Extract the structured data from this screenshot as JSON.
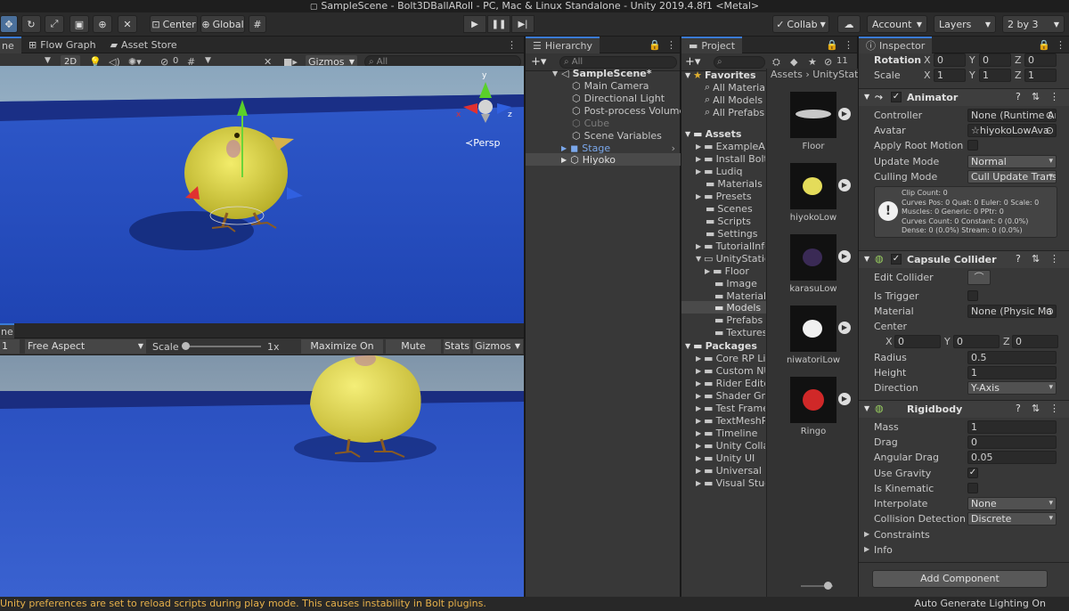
{
  "window": {
    "title": "SampleScene - Bolt3DBallARoll - PC, Mac & Linux Standalone - Unity 2019.4.8f1 <Metal>"
  },
  "toolbar": {
    "pivot_label": "Center",
    "space_label": "Global",
    "collab_label": "Collab",
    "account_label": "Account",
    "layers_label": "Layers",
    "layout_label": "2 by 3"
  },
  "scene_panel": {
    "tabs": [
      "ne",
      "Flow Graph",
      "Asset Store"
    ],
    "mode_2d": "2D",
    "fx_count": "0",
    "gizmos_label": "Gizmos",
    "search_placeholder": "All",
    "persp_label": "Persp",
    "axis_x": "x",
    "axis_z": "z",
    "axis_y": "y"
  },
  "game_panel": {
    "tab": "ne",
    "display": "1",
    "aspect": "Free Aspect",
    "scale_label": "Scale",
    "scale_value": "1x",
    "maximize": "Maximize On Play",
    "mute": "Mute Audio",
    "stats": "Stats",
    "gizmos": "Gizmos"
  },
  "hierarchy": {
    "title": "Hierarchy",
    "search_placeholder": "All",
    "scene_name": "SampleScene*",
    "items": [
      "Main Camera",
      "Directional Light",
      "Post-process Volume",
      "Cube",
      "Scene Variables",
      "Stage",
      "Hiyoko"
    ]
  },
  "project": {
    "title": "Project",
    "hidden_count": "11",
    "breadcrumb": [
      "Assets",
      "UnityStatic"
    ],
    "favorites_label": "Favorites",
    "favorites": [
      "All Materials",
      "All Models",
      "All Prefabs"
    ],
    "assets_label": "Assets",
    "asset_folders": [
      "ExampleAs",
      "Install Bolt",
      "Ludiq",
      "Materials",
      "Presets",
      "Scenes",
      "Scripts",
      "Settings",
      "TutorialInfo",
      "UnityStatic"
    ],
    "unitystatic_children": [
      "Floor",
      "Image",
      "Material",
      "Models",
      "Prefabs",
      "Textures"
    ],
    "packages_label": "Packages",
    "packages": [
      "Core RP Lib",
      "Custom NU",
      "Rider Edito",
      "Shader Gra",
      "Test Frame",
      "TextMeshP",
      "Timeline",
      "Unity Colla",
      "Unity UI",
      "Universal R",
      "Visual Stud"
    ],
    "thumbnails": [
      "Floor",
      "hiyokoLow",
      "karasuLow",
      "niwatoriLow",
      "Ringo"
    ]
  },
  "inspector": {
    "title": "Inspector",
    "rotation_label": "Rotation",
    "rotation": {
      "x": "0",
      "y": "0",
      "z": "0"
    },
    "scale_label": "Scale",
    "scale": {
      "x": "1",
      "y": "1",
      "z": "1"
    },
    "animator": {
      "title": "Animator",
      "controller_label": "Controller",
      "controller": "None (Runtime An",
      "avatar_label": "Avatar",
      "avatar": "hiyokoLowAva",
      "root_motion_label": "Apply Root Motion",
      "update_mode_label": "Update Mode",
      "update_mode": "Normal",
      "culling_mode_label": "Culling Mode",
      "culling_mode": "Cull Update Trans",
      "info_lines": [
        "Clip Count: 0",
        "Curves Pos: 0 Quat: 0 Euler: 0 Scale: 0",
        "Muscles: 0 Generic: 0 PPtr: 0",
        "Curves Count: 0 Constant: 0 (0.0%)",
        "Dense: 0 (0.0%) Stream: 0 (0.0%)"
      ]
    },
    "capsule": {
      "title": "Capsule Collider",
      "edit_label": "Edit Collider",
      "trigger_label": "Is Trigger",
      "material_label": "Material",
      "material": "None (Physic Ma",
      "center_label": "Center",
      "center": {
        "x": "0",
        "y": "0",
        "z": "0"
      },
      "radius_label": "Radius",
      "radius": "0.5",
      "height_label": "Height",
      "height": "1",
      "direction_label": "Direction",
      "direction": "Y-Axis"
    },
    "rigidbody": {
      "title": "Rigidbody",
      "mass_label": "Mass",
      "mass": "1",
      "drag_label": "Drag",
      "drag": "0",
      "angular_label": "Angular Drag",
      "angular": "0.05",
      "gravity_label": "Use Gravity",
      "kinematic_label": "Is Kinematic",
      "interp_label": "Interpolate",
      "interp": "None",
      "collision_label": "Collision Detection",
      "collision": "Discrete",
      "constraints_label": "Constraints",
      "info_label": "Info"
    },
    "add_component": "Add Component"
  },
  "status": {
    "warning": "Unity preferences are set to reload scripts during play mode. This causes instability in Bolt plugins.",
    "right": "Auto Generate Lighting On"
  },
  "colors": {
    "warning": "#e6b04a",
    "selection": "#3a7bd5",
    "scene_blue": "#2a4fbf"
  }
}
